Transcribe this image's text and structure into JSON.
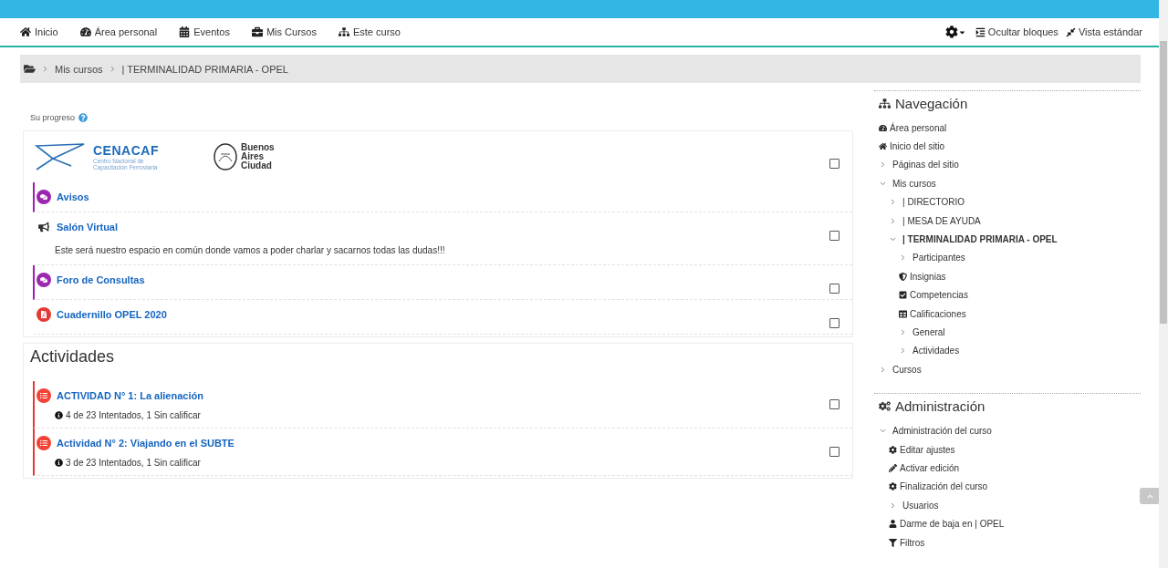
{
  "navbar": {
    "items": [
      {
        "label": "Inicio",
        "kind": "home"
      },
      {
        "label": "Área personal",
        "kind": "dashboard"
      },
      {
        "label": "Eventos",
        "kind": "calendar"
      },
      {
        "label": "Mis Cursos",
        "kind": "briefcase"
      },
      {
        "label": "Este curso",
        "kind": "sitemap"
      }
    ],
    "actions": [
      {
        "label": "Ocultar bloques",
        "kind": "hide-blocks"
      },
      {
        "label": "Vista estándar",
        "kind": "standard-view"
      }
    ]
  },
  "breadcrumb": [
    "Mis cursos",
    "| TERMINALIDAD PRIMARIA - OPEL"
  ],
  "progress_label": "Su progreso",
  "sections": [
    {
      "header": {
        "logo_left": {
          "name": "CENACAF",
          "subtitle": "Centro Nacional de Capacitación Ferroviaria"
        },
        "logo_right": {
          "lines": [
            "Buenos",
            "Aires",
            "Ciudad"
          ]
        },
        "completion": {
          "checked": false
        }
      },
      "items": [
        {
          "kind": "forum",
          "title": "Avisos"
        },
        {
          "kind": "page",
          "title": "Salón Virtual",
          "description": "Este será nuestro espacio en común donde vamos a poder charlar y sacarnos todas las dudas!!!",
          "completion": {
            "checked": false
          }
        },
        {
          "kind": "forum",
          "title": "Foro de Consultas",
          "completion": {
            "checked": false
          }
        },
        {
          "kind": "pdf",
          "title": "Cuadernillo OPEL 2020",
          "completion": {
            "checked": false
          }
        }
      ]
    },
    {
      "title": "Actividades",
      "items": [
        {
          "kind": "quiz",
          "title": "ACTIVIDAD N° 1: La alienación",
          "info": "4 de 23 Intentados, 1 Sin calificar",
          "completion": {
            "checked": false
          }
        },
        {
          "kind": "quiz",
          "title": "Actividad N° 2: Viajando en el SUBTE",
          "info": "3 de 23 Intentados, 1 Sin calificar",
          "completion": {
            "checked": false
          }
        }
      ]
    }
  ],
  "blocks": [
    {
      "kind": "navigation",
      "title": "Navegación",
      "items": [
        {
          "label": "Área personal",
          "kind": "dashboard"
        },
        {
          "label": "Inicio del sitio",
          "kind": "home"
        },
        {
          "label": "Páginas del sitio",
          "kind": "branch",
          "expanded": false
        },
        {
          "label": "Mis cursos",
          "kind": "branch",
          "expanded": true,
          "children": [
            {
              "label": "| DIRECTORIO",
              "kind": "branch",
              "expanded": false,
              "current": false
            },
            {
              "label": "| MESA DE AYUDA",
              "kind": "branch",
              "expanded": false,
              "current": false
            },
            {
              "label": "| TERMINALIDAD PRIMARIA - OPEL",
              "kind": "branch",
              "expanded": true,
              "current": true,
              "children": [
                {
                  "label": "Participantes",
                  "kind": "branch",
                  "expanded": false
                },
                {
                  "label": "Insignias",
                  "kind": "shield"
                },
                {
                  "label": "Competencias",
                  "kind": "check"
                },
                {
                  "label": "Calificaciones",
                  "kind": "table"
                },
                {
                  "label": "General",
                  "kind": "branch",
                  "expanded": false
                },
                {
                  "label": "Actividades",
                  "kind": "branch",
                  "expanded": false
                }
              ]
            }
          ]
        },
        {
          "label": "Cursos",
          "kind": "branch",
          "expanded": false
        }
      ]
    },
    {
      "kind": "administration",
      "title": "Administración",
      "items": [
        {
          "label": "Administración del curso",
          "kind": "branch",
          "expanded": true,
          "children": [
            {
              "label": "Editar ajustes",
              "kind": "gear"
            },
            {
              "label": "Activar edición",
              "kind": "pencil"
            },
            {
              "label": "Finalización del curso",
              "kind": "gear"
            },
            {
              "label": "Usuarios",
              "kind": "branch",
              "expanded": false
            },
            {
              "label": "Darme de baja en | OPEL",
              "kind": "user"
            },
            {
              "label": "Filtros",
              "kind": "filter"
            }
          ]
        }
      ]
    }
  ]
}
